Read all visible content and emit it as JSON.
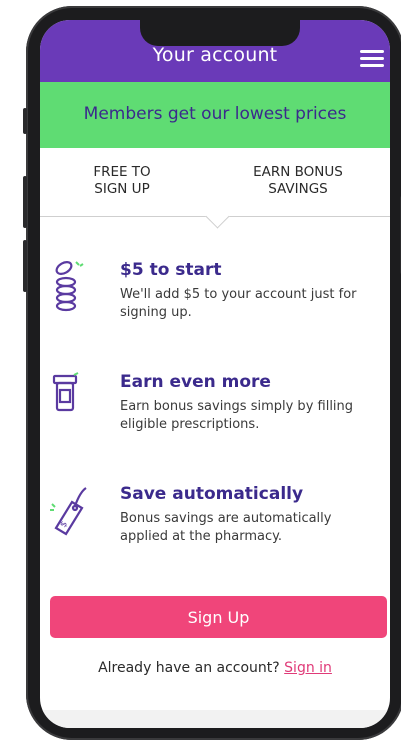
{
  "header": {
    "title": "Your account",
    "menu_icon": "hamburger-menu-icon",
    "background": "#6a3ab8"
  },
  "banner": {
    "text": "Members get our lowest prices",
    "background": "#5fdc73",
    "text_color": "#3b2a8c"
  },
  "tabs": [
    {
      "label": "FREE TO\nSIGN UP"
    },
    {
      "label": "EARN BONUS\nSAVINGS"
    }
  ],
  "benefits": [
    {
      "icon": "coin-stack-icon",
      "title": "$5 to start",
      "description": "We'll add $5 to your account just for signing up."
    },
    {
      "icon": "pill-bottle-icon",
      "title": "Earn even more",
      "description": "Earn bonus savings simply by filling eligible prescriptions."
    },
    {
      "icon": "price-tag-icon",
      "title": "Save automatically",
      "description": "Bonus savings are automatically applied at the pharmacy."
    }
  ],
  "signup_button": {
    "label": "Sign Up",
    "color": "#f0457a"
  },
  "signin": {
    "prompt": "Already have an account?",
    "link_label": "Sign in",
    "link_color": "#e03a78"
  }
}
